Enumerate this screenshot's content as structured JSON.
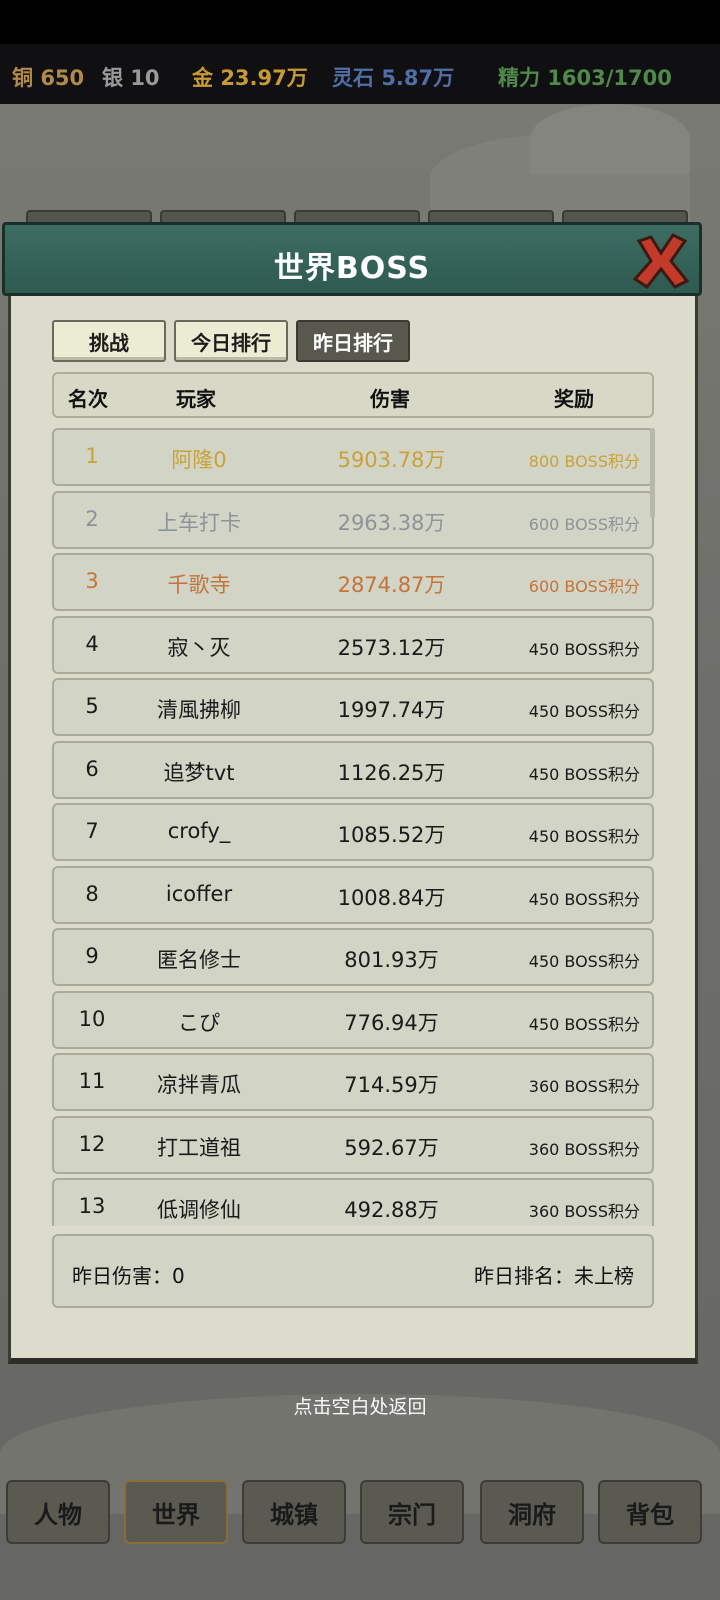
{
  "resources": [
    {
      "name": "铜",
      "value": "650",
      "color": "#b08a4a"
    },
    {
      "name": "银",
      "value": "10",
      "color": "#9a9a9a"
    },
    {
      "name": "金",
      "value": "23.97万",
      "color": "#c79a34"
    },
    {
      "name": "灵石",
      "value": "5.87万",
      "color": "#4f6fa6"
    },
    {
      "name": "精力",
      "value": "1603/1700",
      "color": "#4f8a49"
    }
  ],
  "dialog": {
    "title": "世界BOSS",
    "tabs": [
      {
        "label": "挑战",
        "active": false
      },
      {
        "label": "今日排行",
        "active": false
      },
      {
        "label": "昨日排行",
        "active": true
      }
    ],
    "columns": {
      "rank": "名次",
      "player": "玩家",
      "damage": "伤害",
      "reward": "奖励"
    },
    "rows": [
      {
        "rank": "1",
        "player": "阿隆0",
        "damage": "5903.78万",
        "reward": "800 BOSS积分",
        "color": "#c8a23a"
      },
      {
        "rank": "2",
        "player": "上车打卡",
        "damage": "2963.38万",
        "reward": "600 BOSS积分",
        "color": "#8d939a"
      },
      {
        "rank": "3",
        "player": "千歌寺",
        "damage": "2874.87万",
        "reward": "600 BOSS积分",
        "color": "#c4733b"
      },
      {
        "rank": "4",
        "player": "寂丶灭",
        "damage": "2573.12万",
        "reward": "450 BOSS积分",
        "color": "#1a1a1a"
      },
      {
        "rank": "5",
        "player": "清風拂柳",
        "damage": "1997.74万",
        "reward": "450 BOSS积分",
        "color": "#1a1a1a"
      },
      {
        "rank": "6",
        "player": "追梦tvt",
        "damage": "1126.25万",
        "reward": "450 BOSS积分",
        "color": "#1a1a1a"
      },
      {
        "rank": "7",
        "player": "crofy_",
        "damage": "1085.52万",
        "reward": "450 BOSS积分",
        "color": "#1a1a1a"
      },
      {
        "rank": "8",
        "player": "icoffer",
        "damage": "1008.84万",
        "reward": "450 BOSS积分",
        "color": "#1a1a1a"
      },
      {
        "rank": "9",
        "player": "匿名修士",
        "damage": "801.93万",
        "reward": "450 BOSS积分",
        "color": "#1a1a1a"
      },
      {
        "rank": "10",
        "player": "こぴ",
        "damage": "776.94万",
        "reward": "450 BOSS积分",
        "color": "#1a1a1a"
      },
      {
        "rank": "11",
        "player": "凉拌青瓜",
        "damage": "714.59万",
        "reward": "360 BOSS积分",
        "color": "#1a1a1a"
      },
      {
        "rank": "12",
        "player": "打工道祖",
        "damage": "592.67万",
        "reward": "360 BOSS积分",
        "color": "#1a1a1a"
      },
      {
        "rank": "13",
        "player": "低调修仙",
        "damage": "492.88万",
        "reward": "360 BOSS积分",
        "color": "#1a1a1a"
      }
    ],
    "summary": {
      "damage": "昨日伤害：0",
      "rank": "昨日排名：未上榜"
    },
    "hint": "点击空白处返回"
  },
  "bottom_nav": [
    {
      "label": "人物",
      "active": false
    },
    {
      "label": "世界",
      "active": true
    },
    {
      "label": "城镇",
      "active": false
    },
    {
      "label": "宗门",
      "active": false
    },
    {
      "label": "洞府",
      "active": false
    },
    {
      "label": "背包",
      "active": false
    }
  ]
}
